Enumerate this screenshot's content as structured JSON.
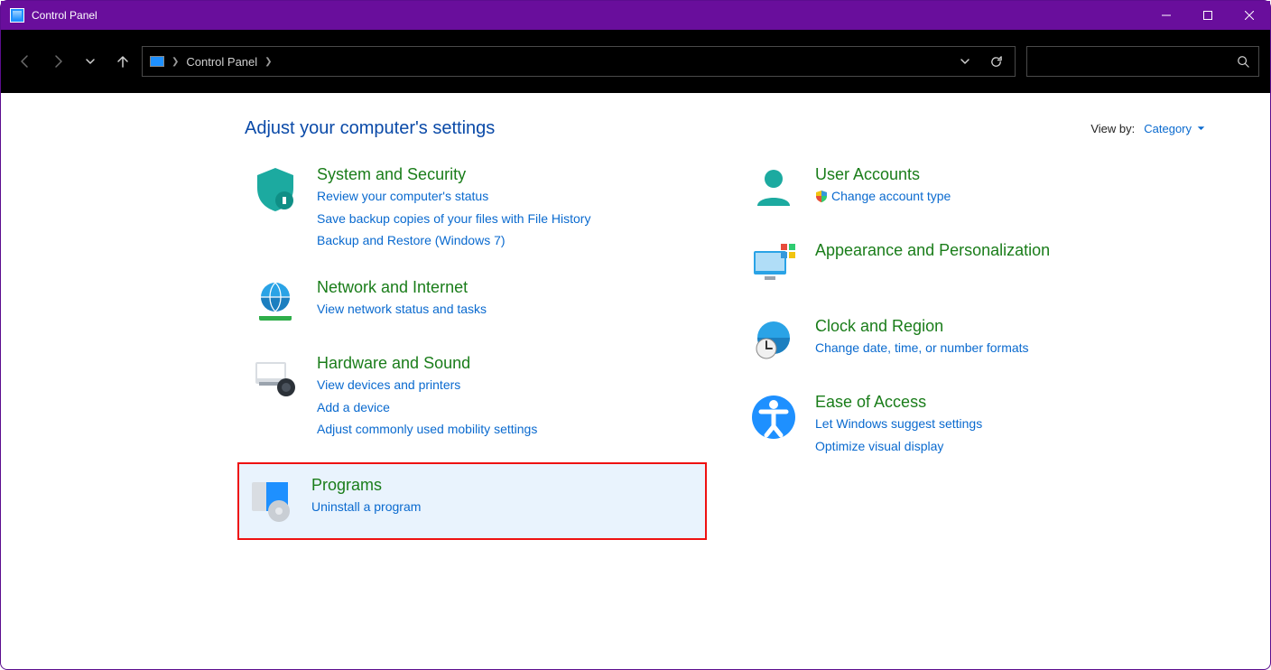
{
  "window": {
    "title": "Control Panel"
  },
  "breadcrumb": {
    "root": "Control Panel"
  },
  "heading": "Adjust your computer's settings",
  "viewby": {
    "label": "View by:",
    "value": "Category"
  },
  "left": [
    {
      "id": "system-security",
      "title": "System and Security",
      "links": [
        "Review your computer's status",
        "Save backup copies of your files with File History",
        "Backup and Restore (Windows 7)"
      ]
    },
    {
      "id": "network-internet",
      "title": "Network and Internet",
      "links": [
        "View network status and tasks"
      ]
    },
    {
      "id": "hardware-sound",
      "title": "Hardware and Sound",
      "links": [
        "View devices and printers",
        "Add a device",
        "Adjust commonly used mobility settings"
      ]
    },
    {
      "id": "programs",
      "title": "Programs",
      "links": [
        "Uninstall a program"
      ],
      "highlighted": true
    }
  ],
  "right": [
    {
      "id": "user-accounts",
      "title": "User Accounts",
      "links": [
        "Change account type"
      ],
      "shield_on_first": true
    },
    {
      "id": "appearance",
      "title": "Appearance and Personalization",
      "links": []
    },
    {
      "id": "clock-region",
      "title": "Clock and Region",
      "links": [
        "Change date, time, or number formats"
      ]
    },
    {
      "id": "ease-of-access",
      "title": "Ease of Access",
      "links": [
        "Let Windows suggest settings",
        "Optimize visual display"
      ]
    }
  ]
}
